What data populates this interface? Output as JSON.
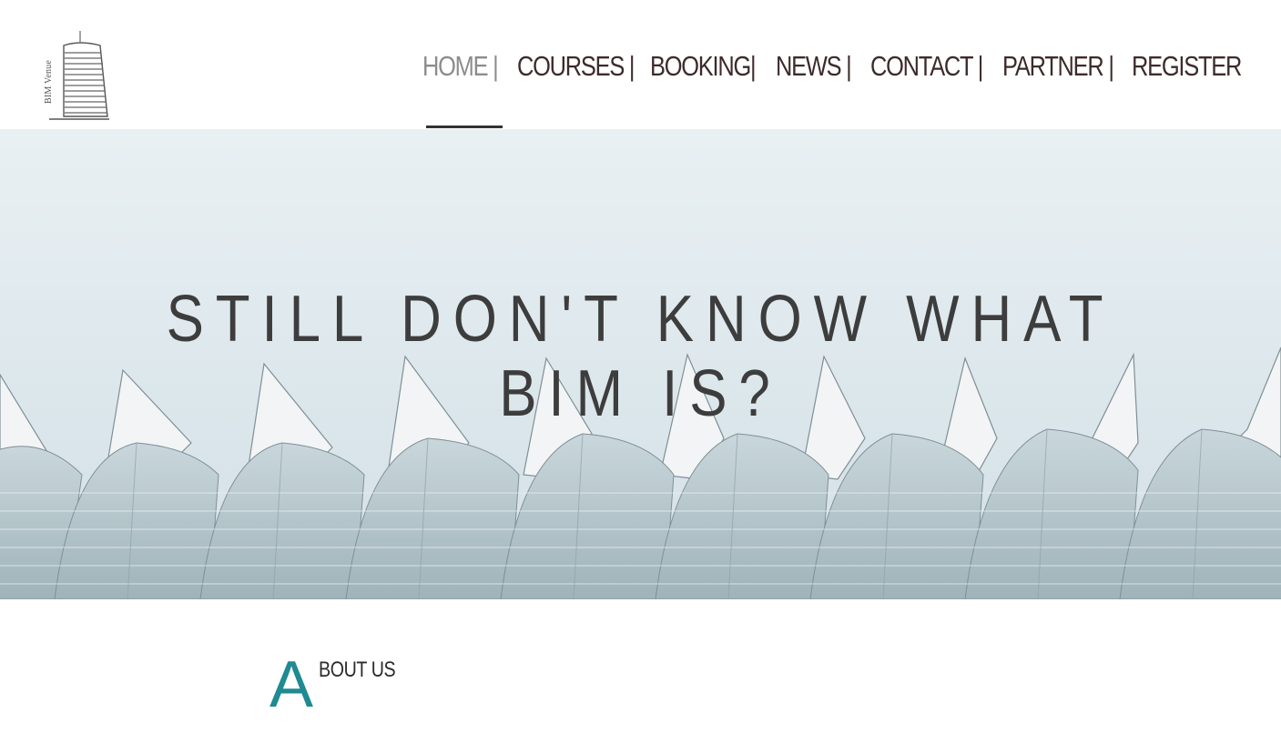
{
  "brand": {
    "logo_text": "BIM Venue"
  },
  "nav": {
    "items": [
      {
        "label": "HOME |"
      },
      {
        "label": "COURSES |"
      },
      {
        "label": "BOOKING|"
      },
      {
        "label": "NEWS |"
      },
      {
        "label": "CONTACT |"
      },
      {
        "label": "PARTNER |"
      },
      {
        "label": "REGISTER"
      }
    ],
    "active": "HOME |"
  },
  "hero": {
    "title": "STILL DON'T KNOW WHAT BIM IS?"
  },
  "about": {
    "initial": "A",
    "rest": "BOUT US"
  },
  "colors": {
    "nav_text": "#3d2b2b",
    "nav_active": "#8c8c8c",
    "accent": "#1f8a92",
    "hero_title": "#3d3d3d"
  }
}
